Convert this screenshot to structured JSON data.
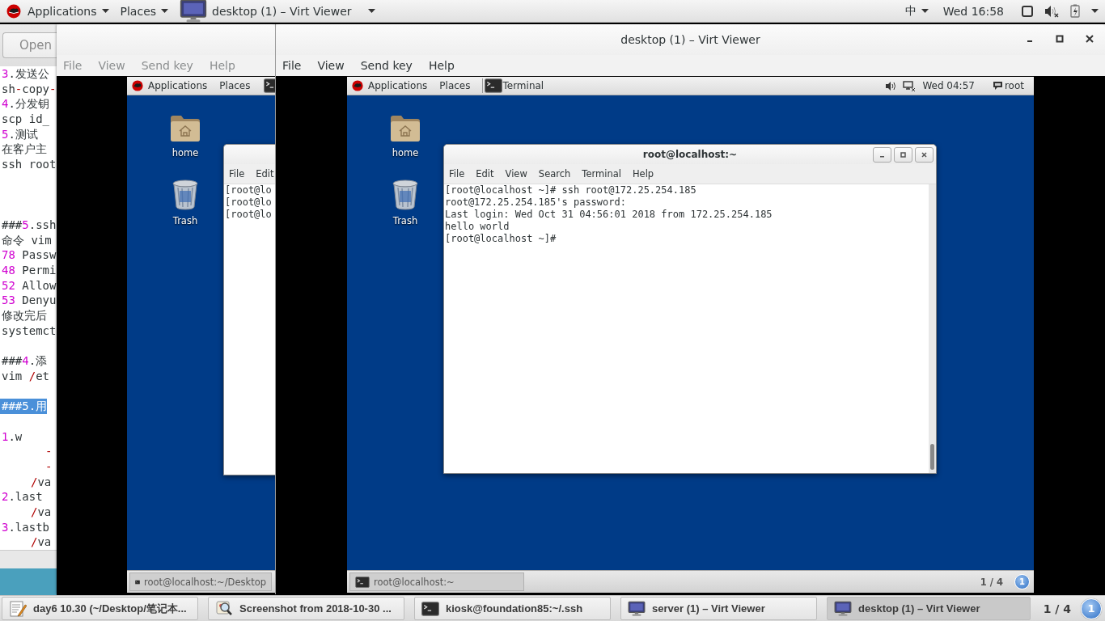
{
  "top_bar": {
    "menus": [
      {
        "label": "Applications",
        "kind": "menu"
      },
      {
        "label": "Places",
        "kind": "menu"
      },
      {
        "label": "desktop (1) – Virt Viewer",
        "kind": "app"
      }
    ],
    "input_method": "中",
    "clock": "Wed 16:58"
  },
  "editor": {
    "open_button": "Open",
    "lines": [
      {
        "kind": "text",
        "selected": false,
        "segments": [
          {
            "kind": "number",
            "text": "3"
          },
          {
            "kind": "plain",
            "text": ".发送公"
          }
        ]
      },
      {
        "kind": "text",
        "selected": false,
        "segments": [
          {
            "kind": "plain",
            "text": "sh"
          },
          {
            "kind": "operator",
            "text": "-"
          },
          {
            "kind": "plain",
            "text": "copy"
          },
          {
            "kind": "operator",
            "text": "-"
          }
        ]
      },
      {
        "kind": "text",
        "selected": false,
        "segments": [
          {
            "kind": "number",
            "text": "4"
          },
          {
            "kind": "plain",
            "text": ".分发钥"
          }
        ]
      },
      {
        "kind": "text",
        "selected": false,
        "segments": [
          {
            "kind": "plain",
            "text": "scp id_"
          }
        ]
      },
      {
        "kind": "text",
        "selected": false,
        "segments": [
          {
            "kind": "number",
            "text": "5"
          },
          {
            "kind": "plain",
            "text": ".测试"
          }
        ]
      },
      {
        "kind": "text",
        "selected": false,
        "segments": [
          {
            "kind": "plain",
            "text": "在客户主"
          }
        ]
      },
      {
        "kind": "text",
        "selected": false,
        "segments": [
          {
            "kind": "plain",
            "text": "ssh root"
          }
        ]
      },
      {
        "kind": "blank",
        "selected": false
      },
      {
        "kind": "blank",
        "selected": false
      },
      {
        "kind": "blank",
        "selected": false
      },
      {
        "kind": "text",
        "selected": false,
        "segments": [
          {
            "kind": "plain",
            "text": "###"
          },
          {
            "kind": "number",
            "text": "5"
          },
          {
            "kind": "plain",
            "text": ".ssh"
          }
        ]
      },
      {
        "kind": "text",
        "selected": false,
        "segments": [
          {
            "kind": "plain",
            "text": "命令 vim"
          }
        ]
      },
      {
        "kind": "text",
        "selected": false,
        "segments": [
          {
            "kind": "number",
            "text": "78"
          },
          {
            "kind": "plain",
            "text": " Passw"
          }
        ]
      },
      {
        "kind": "text",
        "selected": false,
        "segments": [
          {
            "kind": "number",
            "text": "48"
          },
          {
            "kind": "plain",
            "text": " Permi"
          }
        ]
      },
      {
        "kind": "text",
        "selected": false,
        "segments": [
          {
            "kind": "number",
            "text": "52"
          },
          {
            "kind": "plain",
            "text": " Allow"
          }
        ]
      },
      {
        "kind": "text",
        "selected": false,
        "segments": [
          {
            "kind": "number",
            "text": "53"
          },
          {
            "kind": "plain",
            "text": " Denyu"
          }
        ]
      },
      {
        "kind": "text",
        "selected": false,
        "segments": [
          {
            "kind": "plain",
            "text": "修改完后"
          }
        ]
      },
      {
        "kind": "text",
        "selected": false,
        "segments": [
          {
            "kind": "plain",
            "text": "systemct"
          }
        ]
      },
      {
        "kind": "blank",
        "selected": false
      },
      {
        "kind": "text",
        "selected": false,
        "segments": [
          {
            "kind": "plain",
            "text": "###"
          },
          {
            "kind": "number",
            "text": "4"
          },
          {
            "kind": "plain",
            "text": ".添"
          }
        ]
      },
      {
        "kind": "text",
        "selected": false,
        "segments": [
          {
            "kind": "plain",
            "text": "vim "
          },
          {
            "kind": "operator",
            "text": "/"
          },
          {
            "kind": "plain",
            "text": "et"
          }
        ]
      },
      {
        "kind": "blank",
        "selected": false
      },
      {
        "kind": "text",
        "selected": true,
        "segments": [
          {
            "kind": "plain",
            "text": "###5.用"
          }
        ]
      },
      {
        "kind": "blank",
        "selected": false
      },
      {
        "kind": "text",
        "selected": false,
        "segments": [
          {
            "kind": "number",
            "text": "1"
          },
          {
            "kind": "plain",
            "text": ".w"
          }
        ]
      },
      {
        "kind": "option",
        "selected": false,
        "segments": [
          {
            "kind": "operator",
            "text": "-"
          }
        ]
      },
      {
        "kind": "option",
        "selected": false,
        "segments": [
          {
            "kind": "operator",
            "text": "-"
          }
        ]
      },
      {
        "kind": "sub",
        "selected": false,
        "segments": [
          {
            "kind": "operator",
            "text": "/"
          },
          {
            "kind": "plain",
            "text": "va"
          }
        ]
      },
      {
        "kind": "text",
        "selected": false,
        "segments": [
          {
            "kind": "number",
            "text": "2"
          },
          {
            "kind": "plain",
            "text": ".last"
          }
        ]
      },
      {
        "kind": "sub",
        "selected": false,
        "segments": [
          {
            "kind": "operator",
            "text": "/"
          },
          {
            "kind": "plain",
            "text": "va"
          }
        ]
      },
      {
        "kind": "text",
        "selected": false,
        "segments": [
          {
            "kind": "number",
            "text": "3"
          },
          {
            "kind": "plain",
            "text": ".lastb"
          }
        ]
      },
      {
        "kind": "sub",
        "selected": false,
        "segments": [
          {
            "kind": "operator",
            "text": "/"
          },
          {
            "kind": "plain",
            "text": "va"
          }
        ]
      }
    ]
  },
  "server_viewer": {
    "menu": [
      "File",
      "View",
      "Send key",
      "Help"
    ],
    "guest": {
      "top_bar": {
        "menus": [
          "Applications",
          "Places"
        ]
      },
      "desktop_icons": [
        {
          "label": "home",
          "kind": "folder"
        },
        {
          "label": "Trash",
          "kind": "trash"
        }
      ],
      "terminal": {
        "menu": [
          "File",
          "Edit"
        ],
        "lines": [
          "[root@lo",
          "[root@lo",
          "[root@lo"
        ]
      },
      "taskbar": {
        "windows": [
          "root@localhost:~/Desktop"
        ]
      }
    }
  },
  "desktop_viewer": {
    "title": "desktop (1) – Virt Viewer",
    "menu": [
      "File",
      "View",
      "Send key",
      "Help"
    ],
    "guest": {
      "top_bar": {
        "menus": [
          "Applications",
          "Places"
        ],
        "app": "Terminal",
        "clock": "Wed 04:57",
        "user": "root"
      },
      "desktop_icons": [
        {
          "label": "home",
          "kind": "folder"
        },
        {
          "label": "Trash",
          "kind": "trash"
        }
      ],
      "terminal": {
        "title": "root@localhost:~",
        "menu": [
          "File",
          "Edit",
          "View",
          "Search",
          "Terminal",
          "Help"
        ],
        "lines": [
          "[root@localhost ~]# ssh root@172.25.254.185",
          "root@172.25.254.185's password:",
          "Last login: Wed Oct 31 04:56:01 2018 from 172.25.254.185",
          "hello world",
          "[root@localhost ~]# "
        ]
      },
      "taskbar": {
        "windows": [
          "root@localhost:~"
        ],
        "workspace": "1 / 4",
        "notifications": "1"
      }
    }
  },
  "taskbar": {
    "windows": [
      {
        "label": "day6 10.30 (~/Desktop/笔记本...",
        "kind": "editor",
        "selected": false
      },
      {
        "label": "Screenshot from 2018-10-30 ...",
        "kind": "viewer",
        "selected": false
      },
      {
        "label": "kiosk@foundation85:~/.ssh",
        "kind": "terminal",
        "selected": false
      },
      {
        "label": "server (1) – Virt Viewer",
        "kind": "monitor",
        "selected": false
      },
      {
        "label": "desktop (1) – Virt Viewer",
        "kind": "monitor",
        "selected": true
      }
    ],
    "workspace": "1 / 4",
    "notifications": "1"
  }
}
